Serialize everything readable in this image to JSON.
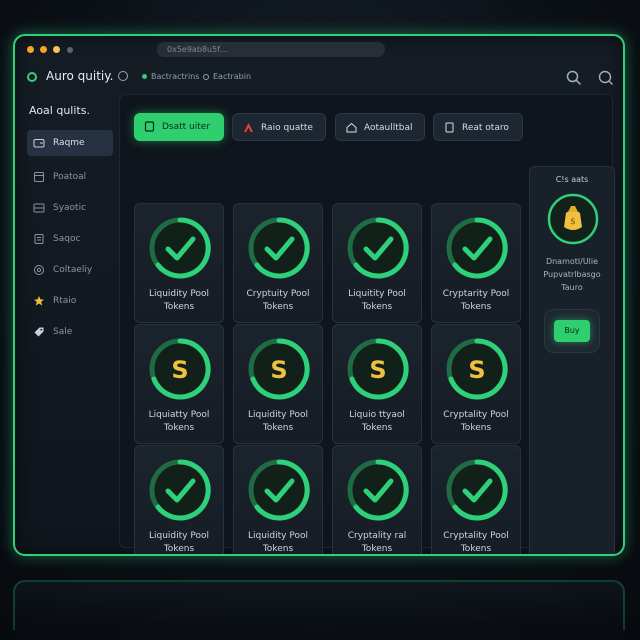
{
  "titlebar": {
    "url": "0x5e9ab8u5f…"
  },
  "header": {
    "brand": "Auro quitiy.",
    "link_1": "Bactractrins",
    "link_2": "Eactrabin"
  },
  "sidebar": {
    "title": "Aoal qulits.",
    "items": [
      {
        "label": "Raqme",
        "icon": "wallet-icon"
      },
      {
        "label": "Poatoal",
        "icon": "portfolio-icon"
      },
      {
        "label": "Syaotic",
        "icon": "swap-icon"
      },
      {
        "label": "Saqoc",
        "icon": "staking-icon"
      },
      {
        "label": "Coltaeliy",
        "icon": "settings-icon"
      },
      {
        "label": "Rtaio",
        "icon": "rewards-icon"
      },
      {
        "label": "Sale",
        "icon": "tag-icon"
      }
    ]
  },
  "tabs": [
    {
      "label": "Dsatt uiter"
    },
    {
      "label": "Raio quatte"
    },
    {
      "label": "Aotaulltbal"
    },
    {
      "label": "Reat otaro"
    }
  ],
  "cards": [
    {
      "line1": "Liquidity Pool",
      "line2": "Tokens",
      "icon": "checkmark-icon"
    },
    {
      "line1": "Cryptuity Pool",
      "line2": "Tokens",
      "icon": "checkmark-icon"
    },
    {
      "line1": "Liquitity Pool",
      "line2": "Tokens",
      "icon": "checkmark-icon"
    },
    {
      "line1": "Cryptarity Pool",
      "line2": "Tokens",
      "icon": "checkmark-icon"
    },
    {
      "line1": "Liquiatty Pool",
      "line2": "Tokens",
      "icon": "token-coin-icon"
    },
    {
      "line1": "Liquidity Pool",
      "line2": "Tokens",
      "icon": "token-coin-icon"
    },
    {
      "line1": "Liquio ttyaol",
      "line2": "Tokens",
      "icon": "token-coin-icon"
    },
    {
      "line1": "Cryptality Pool",
      "line2": "Tokens",
      "icon": "token-coin-icon"
    },
    {
      "line1": "Liquidity Pool",
      "line2": "Tokens",
      "icon": "checkmark-icon"
    },
    {
      "line1": "Liquidity Pool",
      "line2": "Tokens",
      "icon": "checkmark-icon"
    },
    {
      "line1": "Cryptality ral",
      "line2": "Tokens",
      "icon": "checkmark-icon"
    },
    {
      "line1": "Cryptality Pool",
      "line2": "Tokens",
      "icon": "checkmark-icon"
    }
  ],
  "right_panel": {
    "title": "C!s aats",
    "line1": "Dnamotl/Ulie",
    "line2": "Pupvatrlbasgo",
    "line3": "Tauro",
    "button": "Buy"
  },
  "colors": {
    "accent": "#2fd07a",
    "gold": "#f0c040"
  }
}
